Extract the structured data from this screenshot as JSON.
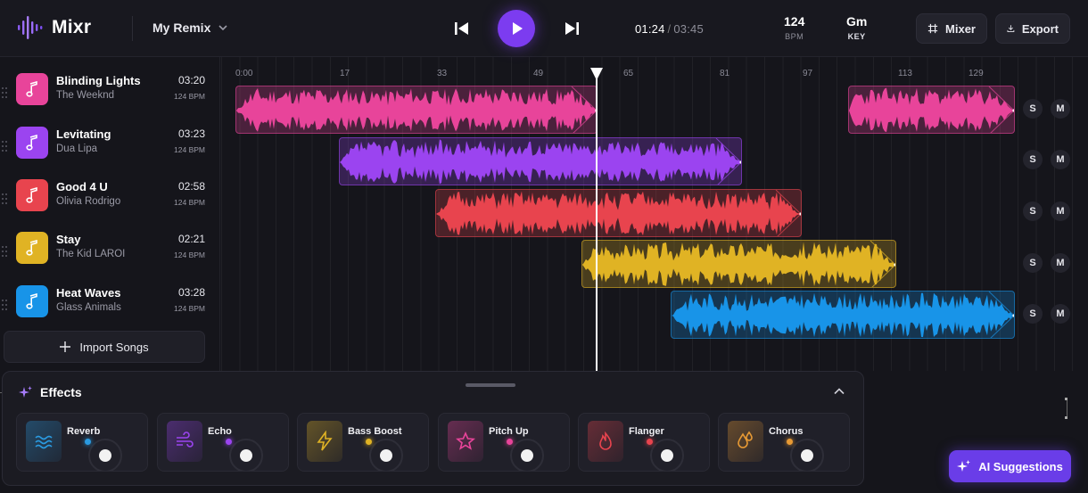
{
  "app": {
    "name": "Mixr"
  },
  "header": {
    "project_name": "My Remix",
    "time_current": "01:24",
    "time_separator": "/",
    "time_total": "03:45",
    "bpm_value": "124",
    "bpm_label": "BPM",
    "key_value": "Gm",
    "key_label": "KEY",
    "mixer_label": "Mixer",
    "export_label": "Export"
  },
  "tracks": [
    {
      "name": "Blinding Lights",
      "artist": "The Weeknd",
      "duration": "03:20",
      "bpm": "124 BPM",
      "color": "#e8449a"
    },
    {
      "name": "Levitating",
      "artist": "Dua Lipa",
      "duration": "03:23",
      "bpm": "124 BPM",
      "color": "#9b44f0"
    },
    {
      "name": "Good 4 U",
      "artist": "Olivia Rodrigo",
      "duration": "02:58",
      "bpm": "124 BPM",
      "color": "#e8444e"
    },
    {
      "name": "Stay",
      "artist": "The Kid LAROI",
      "duration": "02:21",
      "bpm": "124 BPM",
      "color": "#e0b324"
    },
    {
      "name": "Heat Waves",
      "artist": "Glass Animals",
      "duration": "03:28",
      "bpm": "124 BPM",
      "color": "#1894e8"
    }
  ],
  "import_label": "Import Songs",
  "ruler": [
    "0:00",
    "17",
    "33",
    "49",
    "65",
    "81",
    "97",
    "113",
    "129"
  ],
  "solo_label": "S",
  "mute_label": "M",
  "effects": {
    "title": "Effects",
    "items": [
      {
        "label": "Reverb",
        "icon": "waves-icon",
        "color": "#2a9ae0"
      },
      {
        "label": "Echo",
        "icon": "wind-icon",
        "color": "#9b44f0"
      },
      {
        "label": "Bass Boost",
        "icon": "bolt-icon",
        "color": "#e0b324"
      },
      {
        "label": "Pitch Up",
        "icon": "star-icon",
        "color": "#e8449a"
      },
      {
        "label": "Flanger",
        "icon": "flame-icon",
        "color": "#e8444e"
      },
      {
        "label": "Chorus",
        "icon": "drops-icon",
        "color": "#e89a34"
      }
    ]
  },
  "ai_suggestions_label": "AI Suggestions"
}
